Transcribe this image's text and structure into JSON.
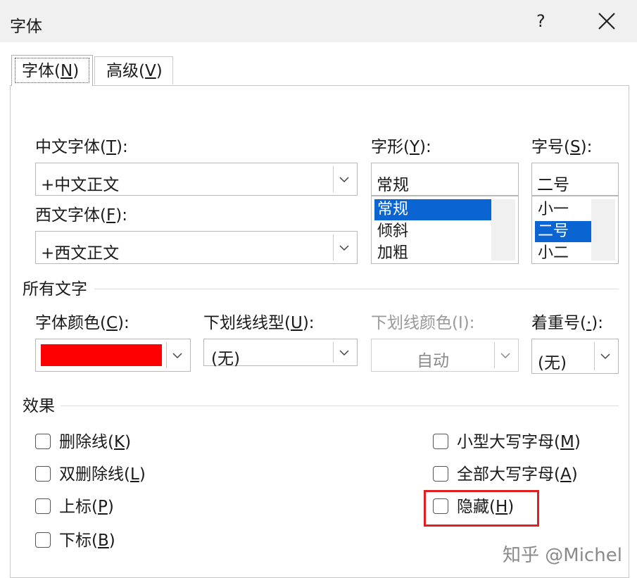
{
  "window": {
    "title": "字体",
    "help": "?"
  },
  "tabs": [
    {
      "pre": "字体(",
      "key": "N",
      "post": ")"
    },
    {
      "pre": "高级(",
      "key": "V",
      "post": ")"
    }
  ],
  "labels": {
    "cn_font": {
      "pre": "中文字体(",
      "key": "T",
      "post": "):"
    },
    "west_font": {
      "pre": "西文字体(",
      "key": "F",
      "post": "):"
    },
    "style": {
      "pre": "字形(",
      "key": "Y",
      "post": "):"
    },
    "size": {
      "pre": "字号(",
      "key": "S",
      "post": "):"
    },
    "all_text": "所有文字",
    "font_color": {
      "pre": "字体颜色(",
      "key": "C",
      "post": "):"
    },
    "underline_style": {
      "pre": "下划线线型(",
      "key": "U",
      "post": "):"
    },
    "underline_color": "下划线颜色(I):",
    "emphasis": {
      "pre": "着重号(",
      "key": "·",
      "post": "):"
    },
    "effects": "效果"
  },
  "values": {
    "cn_font": "+中文正文",
    "west_font": "+西文正文",
    "style": "常规",
    "size": "二号",
    "font_color": "#ff0000",
    "underline_style": "(无)",
    "underline_color": "自动",
    "emphasis": "(无)"
  },
  "style_list": [
    {
      "label": "常规",
      "selected": true
    },
    {
      "label": "倾斜",
      "selected": false
    },
    {
      "label": "加粗",
      "selected": false
    }
  ],
  "size_list": [
    {
      "label": "小一",
      "selected": false
    },
    {
      "label": "二号",
      "selected": true
    },
    {
      "label": "小二",
      "selected": false
    }
  ],
  "effects_left": [
    {
      "pre": "删除线(",
      "key": "K",
      "post": ")",
      "checked": false
    },
    {
      "pre": "双删除线(",
      "key": "L",
      "post": ")",
      "checked": false
    },
    {
      "pre": "上标(",
      "key": "P",
      "post": ")",
      "checked": false
    },
    {
      "pre": "下标(",
      "key": "B",
      "post": ")",
      "checked": false
    }
  ],
  "effects_right": [
    {
      "pre": "小型大写字母(",
      "key": "M",
      "post": ")",
      "checked": false
    },
    {
      "pre": "全部大写字母(",
      "key": "A",
      "post": ")",
      "checked": false
    },
    {
      "pre": "隐藏(",
      "key": "H",
      "post": ")",
      "checked": false
    }
  ],
  "colors": {
    "highlight_box": "#e02020",
    "selection": "#0a64d2"
  },
  "watermark": "知乎 @Michel"
}
